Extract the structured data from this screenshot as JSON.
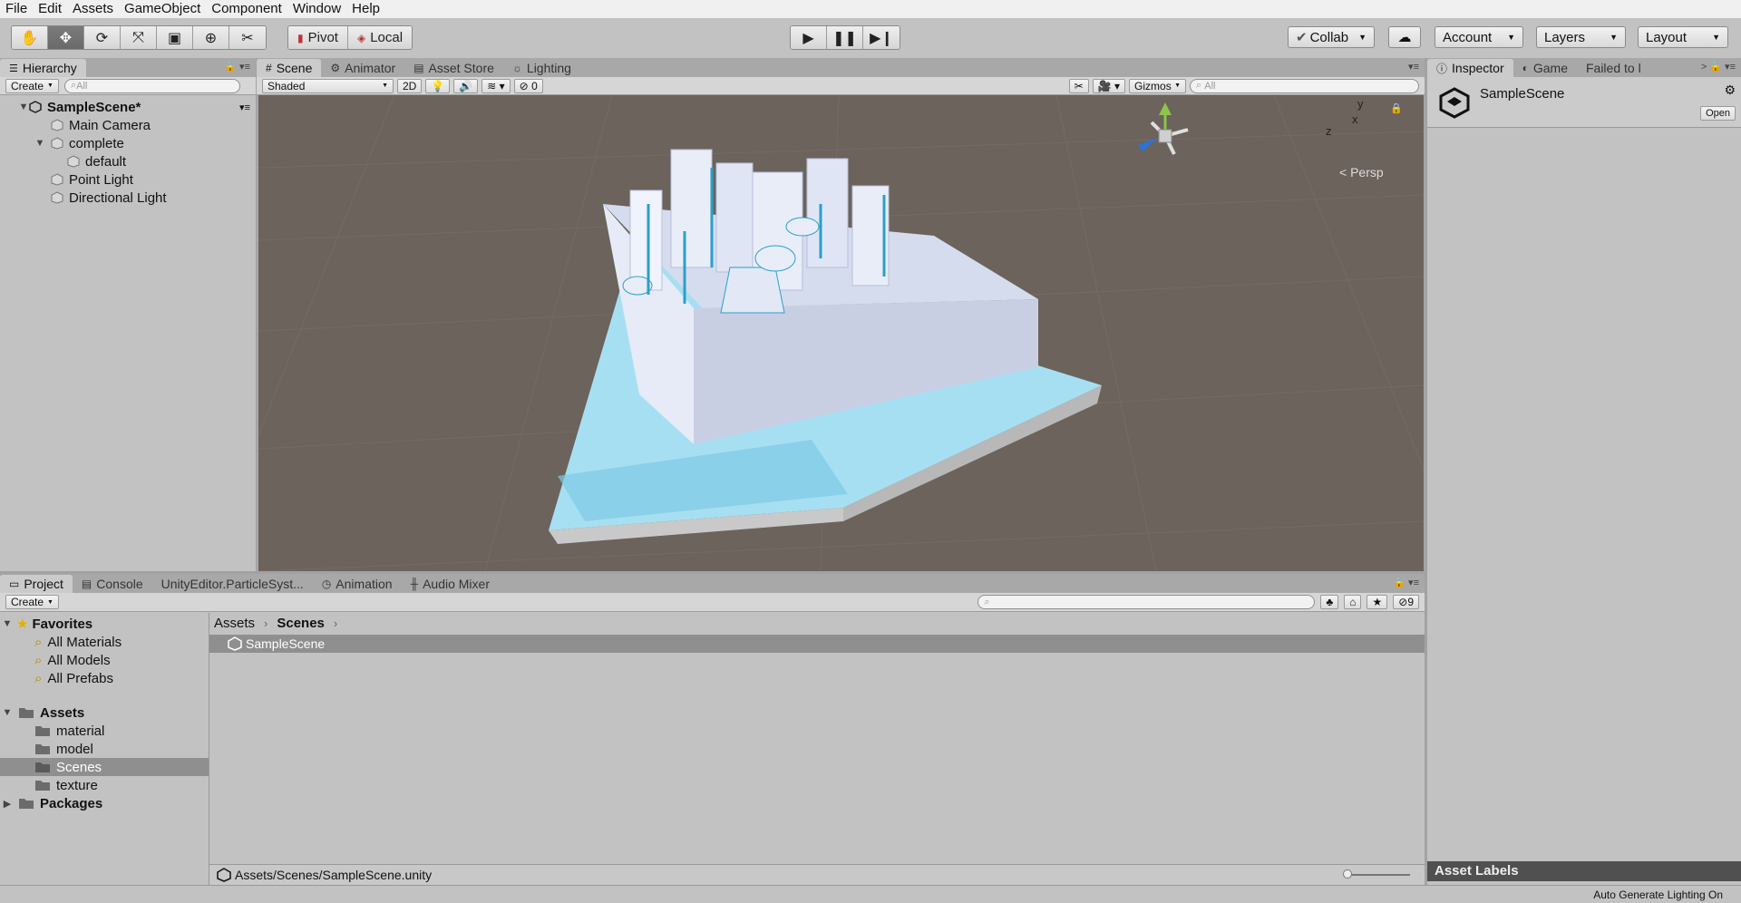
{
  "menu": [
    "File",
    "Edit",
    "Assets",
    "GameObject",
    "Component",
    "Window",
    "Help"
  ],
  "toolbar": {
    "pivot": "Pivot",
    "local": "Local",
    "collab": "Collab",
    "account": "Account",
    "layers": "Layers",
    "layout": "Layout"
  },
  "hierarchy": {
    "tab": "Hierarchy",
    "create": "Create",
    "search_placeholder": "All",
    "scene": "SampleScene*",
    "items": [
      "Main Camera",
      "complete",
      "default",
      "Point Light",
      "Directional Light"
    ]
  },
  "scene_tabs": [
    "Scene",
    "Animator",
    "Asset Store",
    "Lighting"
  ],
  "scene_toolbar": {
    "shading": "Shaded",
    "mode_2d": "2D",
    "hidden_count": "0",
    "gizmos": "Gizmos",
    "search_placeholder": "All"
  },
  "scene_gizmo": {
    "y": "y",
    "x": "x",
    "z": "z",
    "persp": "Persp"
  },
  "inspector": {
    "tabs": [
      "Inspector",
      "Game",
      "Failed to l"
    ],
    "asset_name": "SampleScene",
    "open": "Open",
    "asset_labels": "Asset Labels"
  },
  "project_tabs": [
    "Project",
    "Console",
    "UnityEditor.ParticleSyst...",
    "Animation",
    "Audio Mixer"
  ],
  "project": {
    "create": "Create",
    "favorites": "Favorites",
    "favorite_items": [
      "All Materials",
      "All Models",
      "All Prefabs"
    ],
    "assets": "Assets",
    "asset_folders": [
      "material",
      "model",
      "Scenes",
      "texture"
    ],
    "packages": "Packages",
    "breadcrumb": [
      "Assets",
      "Scenes"
    ],
    "files": [
      "SampleScene"
    ],
    "path": "Assets/Scenes/SampleScene.unity",
    "badge": "9"
  },
  "status": {
    "right": "Auto Generate Lighting On"
  },
  "colors": {
    "selection": "#8f8f8f",
    "scene_bg": "#6b635c",
    "model": "#dfe6f5",
    "water": "#8fd6ef",
    "accent": "#2aa0c9"
  }
}
